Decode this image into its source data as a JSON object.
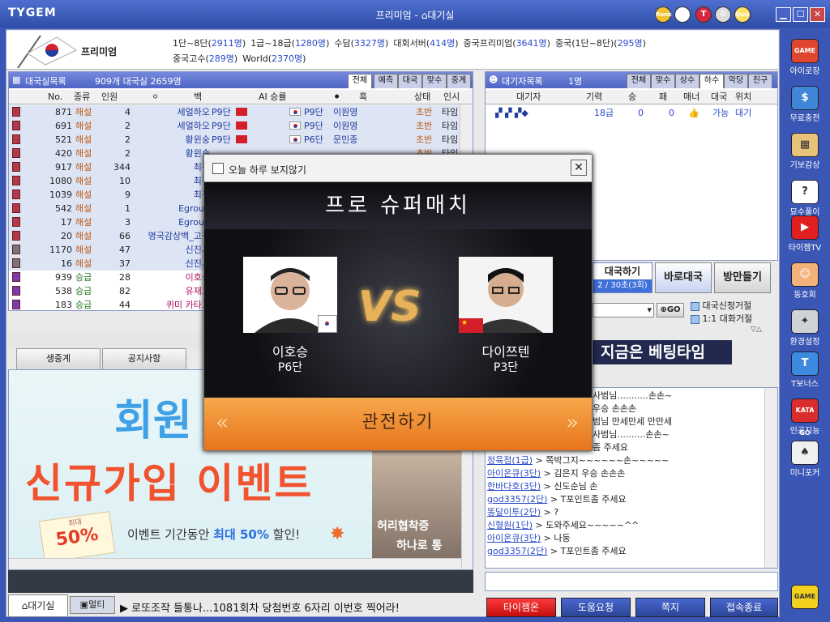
{
  "window": {
    "logo": "TYGEM",
    "title_prefix": "프리미엄 - ",
    "title_suffix": "대기실"
  },
  "titlebar_icons": [
    {
      "name": "rank-icon",
      "label": "Rank",
      "color": "#f1c232"
    },
    {
      "name": "mascot-icon",
      "label": "",
      "color": "#ffffff"
    },
    {
      "name": "t-icon",
      "label": "T",
      "color": "#d7263d"
    },
    {
      "name": "gear-icon",
      "label": "⚙",
      "color": "#dddddd"
    },
    {
      "name": "quiz-icon",
      "label": "Quiz",
      "color": "#ffe066"
    }
  ],
  "window_buttons": [
    "▁",
    "☐",
    "✕"
  ],
  "info": {
    "premium_label": "프리미엄",
    "stats": [
      {
        "label": "1단~8단",
        "count": "2911명"
      },
      {
        "label": "1급~18급",
        "count": "1280명"
      },
      {
        "label": "수담",
        "count": "3327명"
      },
      {
        "label": "대회서버",
        "count": "414명"
      },
      {
        "label": "중국프리미엄",
        "count": "3641명"
      },
      {
        "label": "중국(1단~8단)",
        "count": "295명"
      },
      {
        "label": "중국고수",
        "count": "289명"
      },
      {
        "label": "World",
        "count": "2370명"
      }
    ]
  },
  "games": {
    "header_title": "대국실목록",
    "header_counts": "909개 대국실   2659명",
    "tabs": [
      "전체",
      "예측",
      "대국",
      "맞수",
      "중계"
    ],
    "columns": {
      "no": "No.",
      "type": "종류",
      "people": "인원",
      "white": "백",
      "ai": "AI 승률",
      "black": "흑",
      "status": "상태",
      "extra": "인시"
    },
    "rows": [
      {
        "no": "871",
        "type": "해설",
        "people": "4",
        "white": "세얼하오",
        "wr": "P9단",
        "wf": "cn",
        "bf": "kr",
        "br": "P9단",
        "black": "이원영",
        "status": "초반",
        "extra": "타임"
      },
      {
        "no": "691",
        "type": "해설",
        "people": "2",
        "white": "세얼하오",
        "wr": "P9단",
        "wf": "cn",
        "bf": "kr",
        "br": "P9단",
        "black": "이원영",
        "status": "초반",
        "extra": "타임"
      },
      {
        "no": "521",
        "type": "해설",
        "people": "2",
        "white": "황윈숭",
        "wr": "P9단",
        "wf": "cn",
        "bf": "kr",
        "br": "P6단",
        "black": "문민종",
        "status": "초반",
        "extra": "타임"
      },
      {
        "no": "420",
        "type": "해설",
        "people": "2",
        "white": "황윈숭",
        "wr": "",
        "wf": "",
        "bf": "",
        "br": "",
        "black": "",
        "status": "초반",
        "extra": "타임"
      },
      {
        "no": "917",
        "type": "해설",
        "people": "344",
        "white": "최정",
        "wr": "",
        "wf": "",
        "bf": "",
        "br": "",
        "black": "",
        "status": "",
        "extra": ""
      },
      {
        "no": "1080",
        "type": "해설",
        "people": "10",
        "white": "최정",
        "wr": "",
        "wf": "",
        "bf": "",
        "br": "",
        "black": "",
        "status": "",
        "extra": ""
      },
      {
        "no": "1039",
        "type": "해설",
        "people": "9",
        "white": "최정",
        "wr": "",
        "wf": "",
        "bf": "",
        "br": "",
        "black": "",
        "status": "",
        "extra": ""
      },
      {
        "no": "542",
        "type": "해설",
        "people": "1",
        "white": "Egroup",
        "wr": "",
        "wf": "",
        "bf": "",
        "br": "",
        "black": "",
        "status": "",
        "extra": ""
      },
      {
        "no": "17",
        "type": "해설",
        "people": "3",
        "white": "Egroup",
        "wr": "",
        "wf": "",
        "bf": "",
        "br": "",
        "black": "",
        "status": "",
        "extra": ""
      },
      {
        "no": "20",
        "type": "해설",
        "people": "66",
        "white": "명국감상백_고정",
        "wr": "",
        "wf": "",
        "bf": "",
        "br": "",
        "black": "",
        "status": "",
        "extra": ""
      },
      {
        "no": "1170",
        "type": "해설",
        "people": "47",
        "white": "신진서",
        "wr": "",
        "wf": "",
        "bf": "",
        "br": "",
        "black": "",
        "status": "",
        "extra": ""
      },
      {
        "no": "16",
        "type": "해설",
        "people": "37",
        "white": "신진서",
        "wr": "",
        "wf": "",
        "bf": "",
        "br": "",
        "black": "",
        "status": "",
        "extra": ""
      },
      {
        "no": "939",
        "type": "승급",
        "people": "28",
        "white": "이호승",
        "wr": "",
        "wf": "",
        "bf": "",
        "br": "",
        "black": "",
        "status": "",
        "extra": ""
      },
      {
        "no": "538",
        "type": "승급",
        "people": "82",
        "white": "유재호",
        "wr": "",
        "wf": "",
        "bf": "",
        "br": "",
        "black": "",
        "status": "",
        "extra": ""
      },
      {
        "no": "183",
        "type": "승급",
        "people": "44",
        "white": "퀴미 카타고",
        "wr": "",
        "wf": "",
        "bf": "",
        "br": "",
        "black": "",
        "status": "",
        "extra": ""
      }
    ]
  },
  "waiting": {
    "header_title": "대기자목록",
    "header_count": "1명",
    "tabs": [
      "전체",
      "맞수",
      "상수",
      "하수",
      "악당",
      "친구"
    ],
    "columns": {
      "name": "대기자",
      "rank": "기력",
      "win": "승",
      "loss": "패",
      "manner": "매너",
      "game": "대국",
      "location": "위치"
    },
    "row": {
      "rank": "18급",
      "win": "0",
      "loss": "0",
      "game": "가능",
      "location": "대기"
    },
    "game_btn": "대국하기",
    "game_btn_sub": "2 / 30초(3회)",
    "quick_btn": "바로대국",
    "room_btn": "방만들기",
    "go_label": "GO",
    "opt1": "대국신청거절",
    "opt2": "1:1 대화거절"
  },
  "lower_tabs": [
    "생중계",
    "공지사항"
  ],
  "banner": {
    "big": "회원",
    "event_title": "신규가입 이벤트",
    "percent": "50%",
    "percent_small": "최대",
    "text_a": "이벤트 기간동안 ",
    "text_b": "최대 50%",
    "text_c": " 할인!",
    "side_line1": "허리협착증",
    "side_line2": "하나로 통"
  },
  "betting": "지금은 베팅타임",
  "chat": [
    {
      "user": "",
      "text": "사범님...........손손~"
    },
    {
      "user": "",
      "text": "우승 손손손"
    },
    {
      "user": "",
      "text": "범님 만세만세 만만세"
    },
    {
      "user": "",
      "text": "사범님..........손손~"
    },
    {
      "user": "",
      "text": "좀 주세요"
    },
    {
      "user": "정육점(1급)",
      "text": "쪽박그지~~~~~~손~~~~~"
    },
    {
      "user": "아이온큐(3단)",
      "text": "김은지 우승 손손손"
    },
    {
      "user": "한바다호(3단)",
      "text": "신도순님   손"
    },
    {
      "user": "god3357(2단)",
      "text": "T포인트좀 주세요"
    },
    {
      "user": "똥달이투(2단)",
      "text": "?"
    },
    {
      "user": "신혈원(1단)",
      "text": "도와주세요~~~~~^^"
    },
    {
      "user": "아이온큐(3단)",
      "text": "나둥"
    },
    {
      "user": "god3357(2단)",
      "text": "T포인트좀 주세요"
    }
  ],
  "popup": {
    "checkbox": "오늘 하루 보지않기",
    "title": "프로 슈퍼매치",
    "vs": "VS",
    "left": {
      "name": "이호승",
      "rank": "P6단"
    },
    "right": {
      "name": "다이쯔텐",
      "rank": "P3단"
    },
    "watch_btn": "관전하기"
  },
  "bottom": {
    "tab1": "대기실",
    "tab2": "멀티",
    "ticker": "▶ 로또조작 들통나...1081회차 당첨번호 6자리 이번호 찍어라!",
    "btn_tygem": "타이젬온",
    "btn_help": "도움요청",
    "btn_note": "쪽지",
    "btn_exit": "접속종료"
  },
  "sidebar": [
    {
      "name": "sidebar-baduk-dojang",
      "label": "아이로장",
      "icon": "GAME",
      "color": "#e0452f"
    },
    {
      "name": "sidebar-free-charge",
      "label": "무료충전",
      "icon": "$",
      "color": "#3f86d8"
    },
    {
      "name": "sidebar-kibo",
      "label": "기보감상",
      "icon": "▦",
      "color": "#e6c27a"
    },
    {
      "name": "sidebar-tsumego",
      "label": "묘수풀이",
      "icon": "?",
      "color": "#ffffff"
    },
    {
      "name": "sidebar-tygem-tv",
      "label": "타이젬TV",
      "icon": "▶",
      "color": "#e02020"
    },
    {
      "name": "sidebar-club",
      "label": "동호회",
      "icon": "☺",
      "color": "#f3b27a"
    },
    {
      "name": "sidebar-settings",
      "label": "환경설정",
      "icon": "✦",
      "color": "#cfd3d8"
    },
    {
      "name": "sidebar-t-bonus",
      "label": "T보너스",
      "icon": "T",
      "color": "#3c8be0"
    },
    {
      "name": "sidebar-katago",
      "label": "인공지능",
      "icon": "KATA GO",
      "color": "#d92d2d"
    },
    {
      "name": "sidebar-mini-poker",
      "label": "미니포커",
      "icon": "♠",
      "color": "#f0f0f0"
    },
    {
      "name": "sidebar-game",
      "label": "",
      "icon": "GAME",
      "color": "#f2d01e"
    }
  ]
}
